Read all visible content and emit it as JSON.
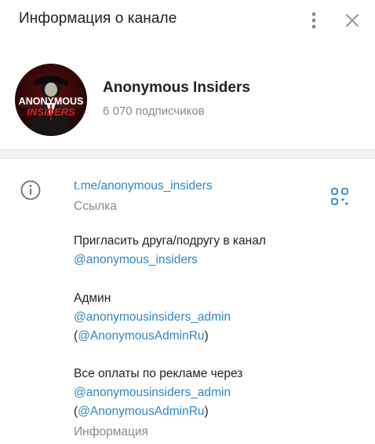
{
  "header": {
    "title": "Информация о канале",
    "more_icon": "kebab-menu-icon",
    "close_icon": "close-icon"
  },
  "profile": {
    "name": "Anonymous Insiders",
    "subscribers": "6 070 подписчиков",
    "avatar_text_line1": "ANONYMOUS",
    "avatar_text_line2": "INSIDERS"
  },
  "link_section": {
    "icon": "info-icon",
    "link": "t.me/anonymous_insiders",
    "link_caption": "Ссылка",
    "qr_icon": "qr-code-icon"
  },
  "description": {
    "invite_text": "Пригласить друга/подругу в канал",
    "invite_handle": "@anonymous_insiders",
    "admin_label": "Админ",
    "admin_handle": "@anonymousinsiders_admin",
    "admin_alt_open": "(",
    "admin_alt_handle": "@AnonymousAdminRu",
    "admin_alt_close": ")",
    "ads_text": "Все оплаты по рекламе через",
    "ads_handle": "@anonymousinsiders_admin",
    "ads_alt_open": "(",
    "ads_alt_handle": "@AnonymousAdminRu",
    "ads_alt_close": ")",
    "caption": "Информация"
  },
  "colors": {
    "link": "#2f87c6",
    "muted": "#8a8a8a",
    "avatar_red": "#c21d1d"
  }
}
